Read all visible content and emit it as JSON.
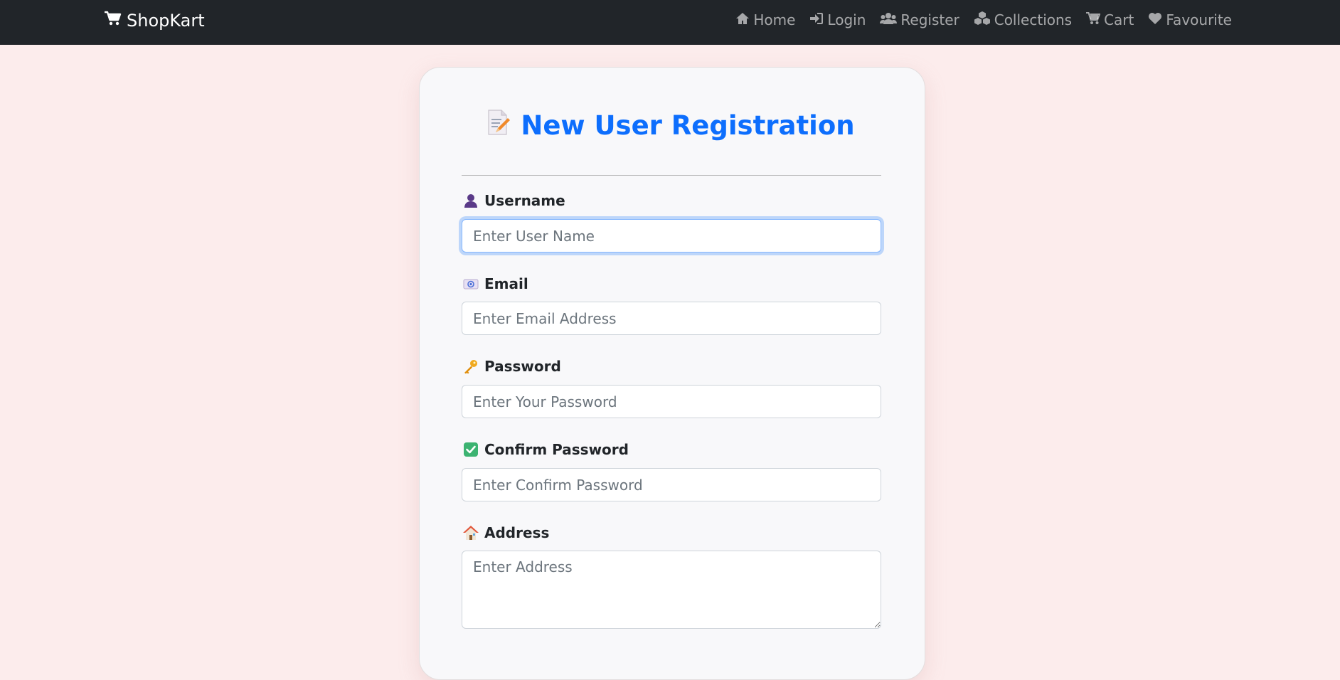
{
  "navbar": {
    "brand": "ShopKart",
    "brand_icon": "cart-icon",
    "links": [
      {
        "label": "Home",
        "icon": "home-icon"
      },
      {
        "label": "Login",
        "icon": "sign-in-icon"
      },
      {
        "label": "Register",
        "icon": "users-icon"
      },
      {
        "label": "Collections",
        "icon": "cubes-icon"
      },
      {
        "label": "Cart",
        "icon": "cart-icon"
      },
      {
        "label": "Favourite",
        "icon": "heart-icon"
      }
    ]
  },
  "form": {
    "title": "New User Registration",
    "title_icon": "memo-icon",
    "fields": {
      "username": {
        "label": "Username",
        "placeholder": "Enter User Name",
        "value": "",
        "icon": "user-silhouette-icon"
      },
      "email": {
        "label": "Email",
        "placeholder": "Enter Email Address",
        "value": "",
        "icon": "email-icon"
      },
      "password": {
        "label": "Password",
        "placeholder": "Enter Your Password",
        "value": "",
        "icon": "key-icon"
      },
      "confirm_password": {
        "label": "Confirm Password",
        "placeholder": "Enter Confirm Password",
        "value": "",
        "icon": "check-box-icon"
      },
      "address": {
        "label": "Address",
        "placeholder": "Enter Address",
        "value": "",
        "icon": "house-icon"
      }
    }
  },
  "colors": {
    "navbar_bg": "#212529",
    "page_bg": "#fcecec",
    "title": "#0d6efd",
    "focus_ring": "#86b7fe"
  }
}
